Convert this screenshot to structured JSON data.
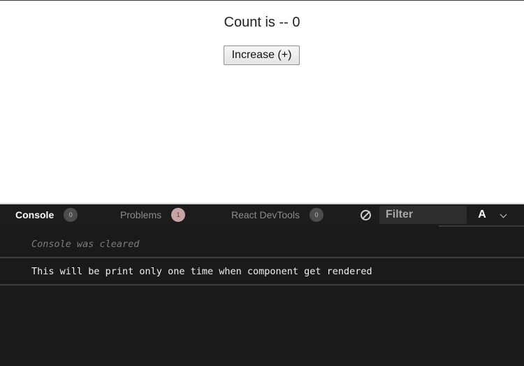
{
  "preview": {
    "count_text": "Count is -- 0",
    "increase_button_label": "Increase (+)"
  },
  "console": {
    "tabs": [
      {
        "label": "Console",
        "badge": "0",
        "active": true
      },
      {
        "label": "Problems",
        "badge": "1",
        "active": false
      },
      {
        "label": "React DevTools",
        "badge": "0",
        "active": false
      }
    ],
    "filter_placeholder": "Filter",
    "font_toggle_label": "A",
    "logs": [
      {
        "type": "info",
        "text": "Console was cleared"
      },
      {
        "type": "message",
        "text": "This will be print only one time when component get rendered"
      }
    ]
  },
  "colors": {
    "console_background": "#1a1a1a",
    "problems_badge": "#c9a4a4",
    "active_tab_text": "#ffffff"
  },
  "icons": {
    "clear_console": "clear-console-icon",
    "collapse": "chevron-down-icon"
  }
}
